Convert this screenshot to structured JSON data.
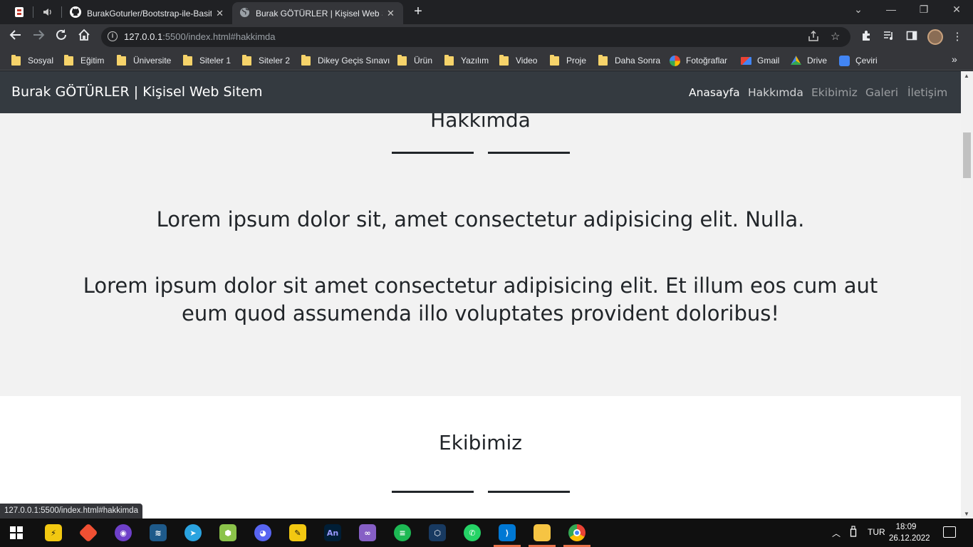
{
  "browser": {
    "tabs": [
      {
        "title": "BurakGoturler/Bootstrap-ile-Basit-Portfolyo",
        "active": false
      },
      {
        "title": "Burak GÖTÜRLER | Kişisel Web Sitem",
        "active": true
      }
    ],
    "url_host": "127.0.0.1",
    "url_rest": ":5500/index.html#hakkimda",
    "bookmarks": [
      {
        "label": "Sosyal",
        "icon": "folder-icon"
      },
      {
        "label": "Eğitim",
        "icon": "folder-icon"
      },
      {
        "label": "Üniversite",
        "icon": "folder-icon"
      },
      {
        "label": "Siteler 1",
        "icon": "folder-icon"
      },
      {
        "label": "Siteler 2",
        "icon": "folder-icon"
      },
      {
        "label": "Dikey Geçis Sınavı",
        "icon": "folder-icon"
      },
      {
        "label": "Ürün",
        "icon": "folder-icon"
      },
      {
        "label": "Yazılım",
        "icon": "folder-icon"
      },
      {
        "label": "Video",
        "icon": "folder-icon"
      },
      {
        "label": "Proje",
        "icon": "folder-icon"
      },
      {
        "label": "Daha Sonra",
        "icon": "folder-icon"
      },
      {
        "label": "Fotoğraflar",
        "icon": "photos-icon"
      },
      {
        "label": "Gmail",
        "icon": "gmail-icon"
      },
      {
        "label": "Drive",
        "icon": "drive-icon"
      },
      {
        "label": "Çeviri",
        "icon": "translate-icon"
      }
    ],
    "status_url": "127.0.0.1:5500/index.html#hakkimda"
  },
  "site": {
    "brand": "Burak GÖTÜRLER | Kişisel Web Sitem",
    "nav": [
      {
        "label": "Anasayfa",
        "active": true
      },
      {
        "label": "Hakkımda",
        "active": true
      },
      {
        "label": "Ekibimiz",
        "active": false
      },
      {
        "label": "Galeri",
        "active": false
      },
      {
        "label": "İletişim",
        "active": false
      }
    ],
    "about": {
      "title": "Hakkımda",
      "lead1": "Lorem ipsum dolor sit, amet consectetur adipisicing elit. Nulla.",
      "lead2_line1": "Lorem ipsum dolor sit amet consectetur adipisicing elit. Et illum eos cum aut",
      "lead2_line2": "eum quod assumenda illo voluptates provident doloribus!"
    },
    "team": {
      "title": "Ekibimiz"
    }
  },
  "taskbar": {
    "apps": [
      "mobaxterm-icon",
      "git-icon",
      "github-desktop-icon",
      "mysql-workbench-icon",
      "telegram-icon",
      "box-icon",
      "discord-icon",
      "paint-icon",
      "animate-icon",
      "visual-studio-icon",
      "spotify-icon",
      "virtualbox-icon",
      "whatsapp-icon",
      "vscode-icon",
      "file-explorer-icon",
      "chrome-icon"
    ],
    "apps_label_animate": "An",
    "lang": "TUR",
    "time": "18:09",
    "date": "26.12.2022"
  },
  "colors": {
    "site_nav_bg": "#343a40",
    "about_bg": "#f2f2f2",
    "browser_dark": "#202124",
    "browser_toolbar": "#35363a"
  }
}
